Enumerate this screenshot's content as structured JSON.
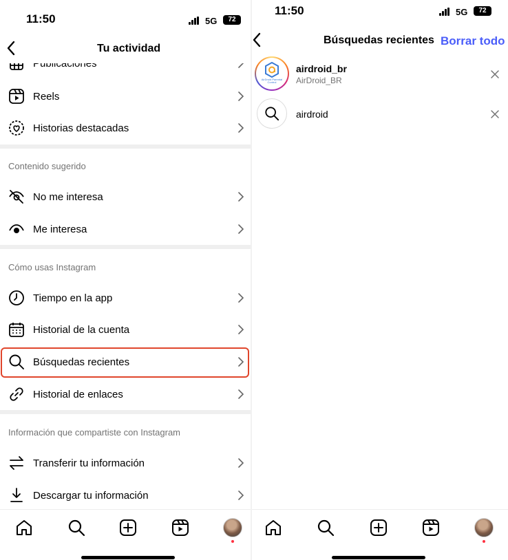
{
  "status_bar": {
    "time": "11:50",
    "network": "5G",
    "battery": "72"
  },
  "left": {
    "title": "Tu actividad",
    "partial_item": "Publicaciones",
    "items_top": [
      {
        "label": "Reels",
        "icon": "reels-icon"
      },
      {
        "label": "Historias destacadas",
        "icon": "highlights-icon"
      }
    ],
    "section_suggested": "Contenido sugerido",
    "items_suggested": [
      {
        "label": "No me interesa",
        "icon": "eye-slash-icon"
      },
      {
        "label": "Me interesa",
        "icon": "eye-icon"
      }
    ],
    "section_usage": "Cómo usas Instagram",
    "items_usage": [
      {
        "label": "Tiempo en la app",
        "icon": "clock-icon"
      },
      {
        "label": "Historial de la cuenta",
        "icon": "calendar-icon"
      },
      {
        "label": "Búsquedas recientes",
        "icon": "search-icon"
      },
      {
        "label": "Historial de enlaces",
        "icon": "link-icon"
      }
    ],
    "section_info": "Información que compartiste con Instagram",
    "items_info": [
      {
        "label": "Transferir tu información",
        "icon": "transfer-icon"
      },
      {
        "label": "Descargar tu información",
        "icon": "download-icon"
      }
    ]
  },
  "right": {
    "title": "Búsquedas recientes",
    "clear_all": "Borrar todo",
    "results": [
      {
        "username": "airdroid_br",
        "subtitle": "AirDroid_BR",
        "logo_text": "AirDroid Parental Control"
      },
      {
        "query": "airdroid"
      }
    ]
  },
  "colors": {
    "highlight": "#e0452b",
    "link": "#4a5df9",
    "notification": "#ff3040"
  }
}
